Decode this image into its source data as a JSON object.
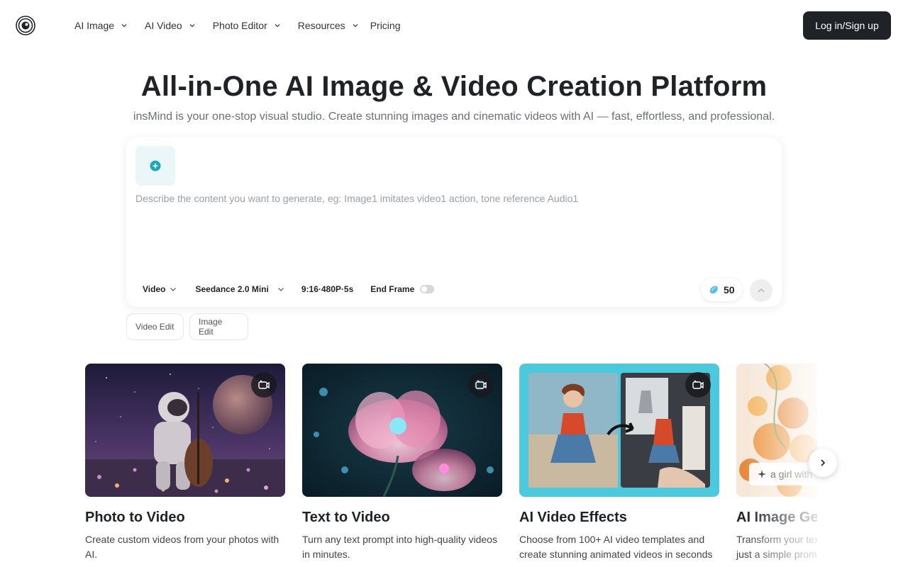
{
  "header": {
    "nav": [
      {
        "label": "AI Image"
      },
      {
        "label": "AI Video"
      },
      {
        "label": "Photo Editor"
      },
      {
        "label": "Resources"
      },
      {
        "label": "Pricing"
      }
    ],
    "login_label": "Log in/Sign up"
  },
  "hero": {
    "title": "All-in-One AI Image & Video Creation Platform",
    "subtitle": "insMind is your one-stop visual studio. Create stunning images and cinematic videos with AI — fast, effortless, and professional."
  },
  "prompt": {
    "placeholder": "Describe the content you want to generate, eg: Image1 imitates video1 action, tone reference Audio1",
    "mode": "Video",
    "model": "Seedance 2.0 Mini",
    "settings": "9:16·480P·5s",
    "end_frame_label": "End Frame",
    "end_frame_on": false,
    "credits": "50"
  },
  "chips": {
    "video_edit": "Video Edit",
    "image_edit": "Image Edit"
  },
  "cards": [
    {
      "title": "Photo to Video",
      "desc": "Create custom videos from your photos with AI."
    },
    {
      "title": "Text to Video",
      "desc": "Turn any text prompt into high-quality videos in minutes."
    },
    {
      "title": "AI Video Effects",
      "desc": "Choose from 100+ AI video templates and create stunning animated videos in seconds"
    },
    {
      "title": "AI Image Generator",
      "desc": "Transform your text into stunning images with just a simple prompt",
      "overlay_prompt": "a girl with"
    }
  ],
  "colors": {
    "primary_dark": "#1f2328",
    "accent_teal": "#1aa7b8",
    "upload_bg": "#eaf6f8",
    "effects_bg": "#4cc9dc"
  }
}
